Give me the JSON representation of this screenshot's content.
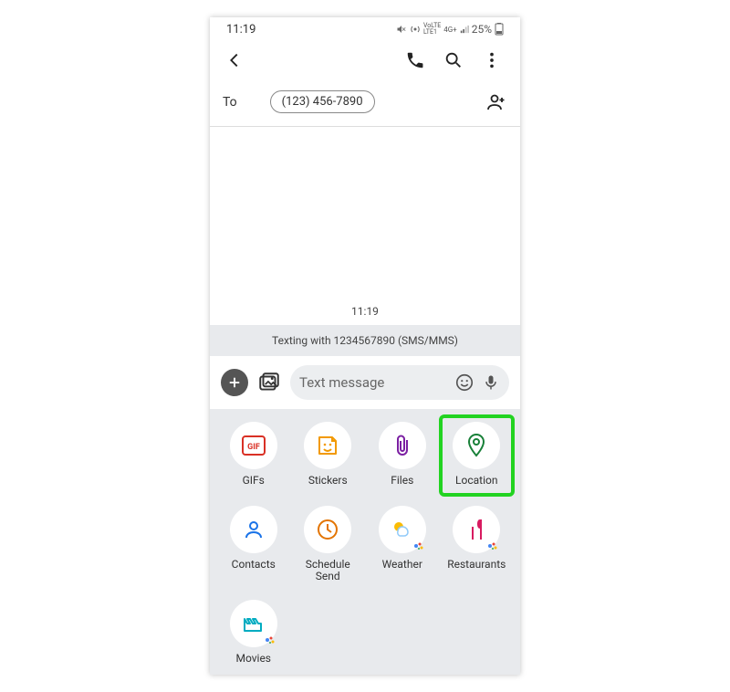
{
  "status": {
    "time": "11:19",
    "battery": "25%"
  },
  "to": {
    "label": "To",
    "recipient": "(123) 456-7890"
  },
  "conversation": {
    "timestamp": "11:19",
    "banner": "Texting with 1234567890 (SMS/MMS)"
  },
  "compose": {
    "placeholder": "Text message"
  },
  "sheet": {
    "items": [
      {
        "label": "GIFs"
      },
      {
        "label": "Stickers"
      },
      {
        "label": "Files"
      },
      {
        "label": "Location"
      },
      {
        "label": "Contacts"
      },
      {
        "label": "Schedule Send"
      },
      {
        "label": "Weather"
      },
      {
        "label": "Restaurants"
      },
      {
        "label": "Movies"
      }
    ]
  }
}
